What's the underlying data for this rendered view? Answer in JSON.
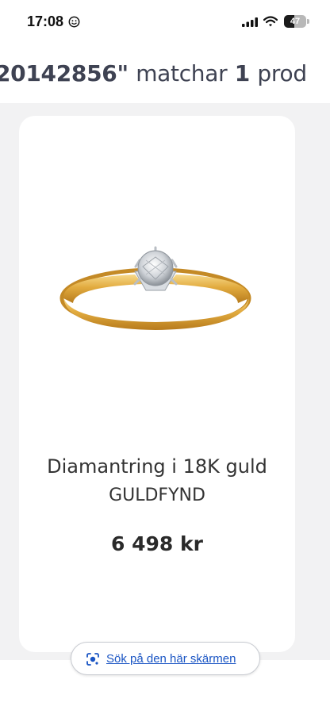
{
  "status_bar": {
    "time": "17:08",
    "battery_level": "47",
    "battery_fraction": 0.47
  },
  "search_results": {
    "query_part": "20142856\"",
    "match_word": "matchar",
    "count": "1",
    "tail_word": "prod"
  },
  "product": {
    "name": "Diamantring i 18K guld",
    "brand": "GULDFYND",
    "price": "6 498 kr",
    "image_icon": "gold-diamond-ring"
  },
  "lens_bar": {
    "label": "Sök på den här skärmen",
    "icon": "google-lens-icon"
  },
  "colors": {
    "heading": "#3e4252",
    "link": "#1a55c4",
    "page_background": "#f2f2f3",
    "card_background": "#ffffff"
  }
}
